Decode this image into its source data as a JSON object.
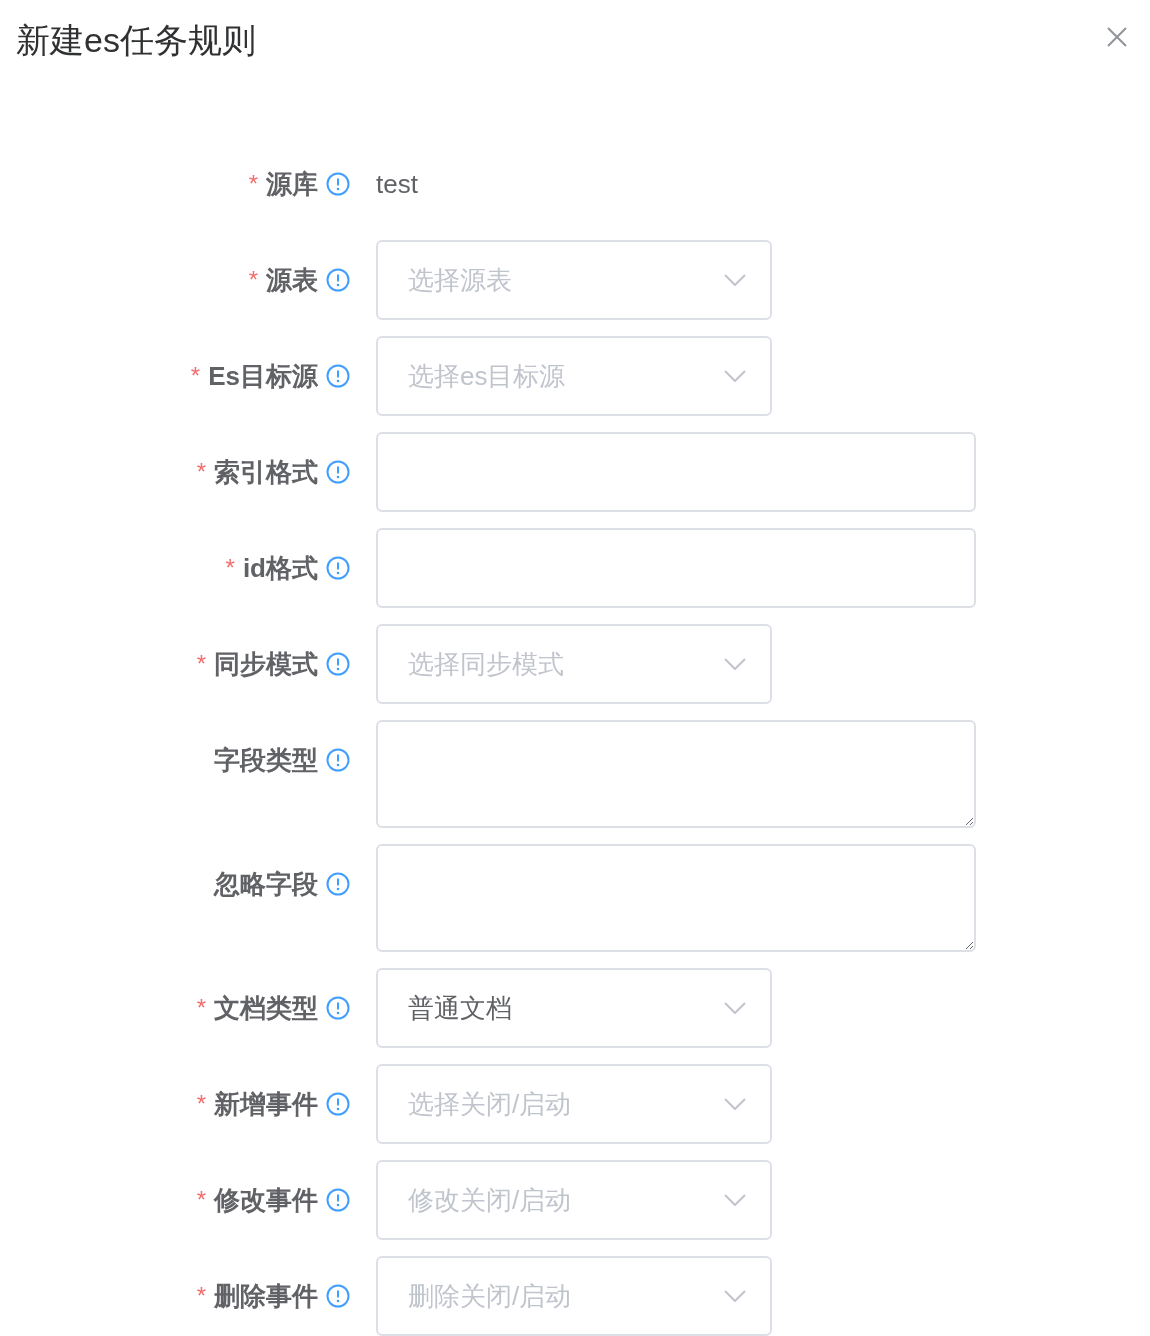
{
  "dialog": {
    "title": "新建es任务规则",
    "close": true
  },
  "fields": [
    {
      "label": "源库",
      "required_mark": "*",
      "kind": "text",
      "value": "test"
    },
    {
      "label": "源表",
      "required_mark": "*",
      "kind": "select",
      "placeholder": "选择源表"
    },
    {
      "label": "Es目标源",
      "required_mark": "*",
      "kind": "select",
      "placeholder": "选择es目标源"
    },
    {
      "label": "索引格式",
      "required_mark": "*",
      "kind": "input"
    },
    {
      "label": "id格式",
      "required_mark": "*",
      "kind": "input"
    },
    {
      "label": "同步模式",
      "required_mark": "*",
      "kind": "select",
      "placeholder": "选择同步模式"
    },
    {
      "label": "字段类型",
      "kind": "textarea"
    },
    {
      "label": "忽略字段",
      "kind": "textarea"
    },
    {
      "label": "文档类型",
      "required_mark": "*",
      "kind": "select",
      "value": "普通文档"
    },
    {
      "label": "新增事件",
      "required_mark": "*",
      "kind": "select",
      "placeholder": "选择关闭/启动"
    },
    {
      "label": "修改事件",
      "required_mark": "*",
      "kind": "select",
      "placeholder": "修改关闭/启动"
    },
    {
      "label": "删除事件",
      "required_mark": "*",
      "kind": "select",
      "placeholder": "删除关闭/启动"
    }
  ]
}
